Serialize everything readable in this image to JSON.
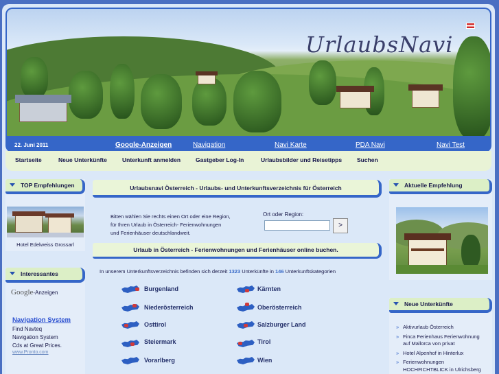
{
  "header": {
    "date": "22. Juni 2011",
    "logo": "UrlaubsNavi",
    "links": [
      "Google-Anzeigen",
      "Navigation",
      "Navi Karte",
      "PDA Navi",
      "Navi Test"
    ]
  },
  "menu": [
    "Startseite",
    "Neue Unterkünfte",
    "Unterkunft anmelden",
    "Gastgeber Log-In",
    "Urlaubsbilder und Reisetipps",
    "Suchen"
  ],
  "left": {
    "top_title": "TOP Empfehlungen",
    "top_caption": "Hotel Edelweiss Grossarl",
    "int_title": "Interessantes",
    "google_word": "Google",
    "ads_word": "-Anzeigen",
    "ad_link": "Navigation System",
    "ad_lines": [
      "Find Navteq",
      "Navigation System",
      "Cds at Great Prices."
    ],
    "ad_url": "www.Pronto.com"
  },
  "center": {
    "title": "Urlaubsnavi Österreich - Urlaubs- und Unterkunftsverzeichnis für Österreich",
    "intro": [
      "Bitten wählen Sie rechts einen Ort oder eine Region,",
      "für Ihren Urlaub in Österreich- Ferienwohnungen",
      "und Ferienhäuser deutschlandweit."
    ],
    "ort_label": "Ort oder Region:",
    "go": ">",
    "sub_title": "Urlaub in Österreich - Ferienwohnungen und Ferienhäuser online buchen.",
    "count_pre": "In unserem Unterkunftsverzeichnis befinden sich derzeit",
    "count_units": "1323",
    "count_mid": "Unterkünfte in",
    "count_cats": "146",
    "count_post": "Unterkunftskategorien",
    "regions_left": [
      "Burgenland",
      "Niederösterreich",
      "Osttirol",
      "Steiermark",
      "Vorarlberg"
    ],
    "regions_right": [
      "Kärnten",
      "Oberösterreich",
      "Salzburger Land",
      "Tirol",
      "Wien"
    ]
  },
  "right": {
    "rec_title": "Aktuelle Empfehlung",
    "new_title": "Neue Unterkünfte",
    "new_items": [
      [
        "Aktivurlaub Österreich"
      ],
      [
        "Finca Ferienhaus Ferienwohnung",
        "auf Mallorca von privat"
      ],
      [
        "Hotel Alpenhof in Hinterlux"
      ],
      [
        "Ferienwohnungen",
        "HOCHFICHTBLICK in Ulrichsberg"
      ]
    ]
  }
}
